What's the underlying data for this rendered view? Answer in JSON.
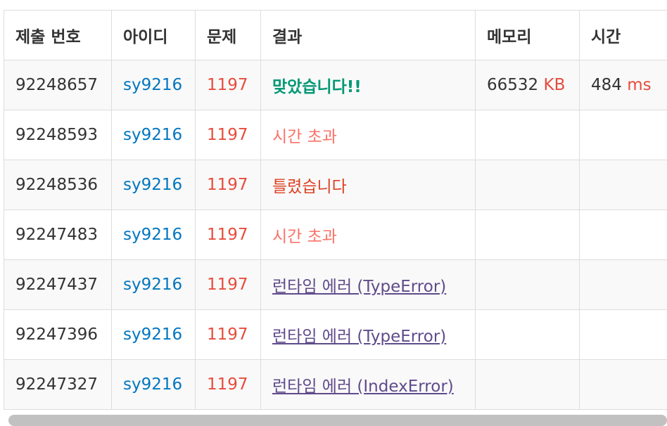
{
  "columns": [
    "제출 번호",
    "아이디",
    "문제",
    "결과",
    "메모리",
    "시간"
  ],
  "rows": [
    {
      "id": "92248657",
      "user": "sy9216",
      "problem": "1197",
      "result": "맞았습니다!!",
      "result_type": "ac",
      "memory": "66532",
      "memory_unit": "KB",
      "time": "484",
      "time_unit": "ms"
    },
    {
      "id": "92248593",
      "user": "sy9216",
      "problem": "1197",
      "result": "시간 초과",
      "result_type": "tle",
      "memory": "",
      "memory_unit": "",
      "time": "",
      "time_unit": ""
    },
    {
      "id": "92248536",
      "user": "sy9216",
      "problem": "1197",
      "result": "틀렸습니다",
      "result_type": "wa",
      "memory": "",
      "memory_unit": "",
      "time": "",
      "time_unit": ""
    },
    {
      "id": "92247483",
      "user": "sy9216",
      "problem": "1197",
      "result": "시간 초과",
      "result_type": "tle",
      "memory": "",
      "memory_unit": "",
      "time": "",
      "time_unit": ""
    },
    {
      "id": "92247437",
      "user": "sy9216",
      "problem": "1197",
      "result": "런타임 에러 (TypeError)",
      "result_type": "rte",
      "memory": "",
      "memory_unit": "",
      "time": "",
      "time_unit": ""
    },
    {
      "id": "92247396",
      "user": "sy9216",
      "problem": "1197",
      "result": "런타임 에러 (TypeError)",
      "result_type": "rte",
      "memory": "",
      "memory_unit": "",
      "time": "",
      "time_unit": ""
    },
    {
      "id": "92247327",
      "user": "sy9216",
      "problem": "1197",
      "result": "런타임 에러 (IndexError)",
      "result_type": "rte",
      "memory": "",
      "memory_unit": "",
      "time": "",
      "time_unit": ""
    }
  ],
  "colors": {
    "user_link": "#0076c0",
    "problem_link": "#e74c3c",
    "accepted": "#009874",
    "time_limit": "#fa7268",
    "wrong_answer": "#dd4124",
    "runtime_error": "#5f4b8b"
  }
}
